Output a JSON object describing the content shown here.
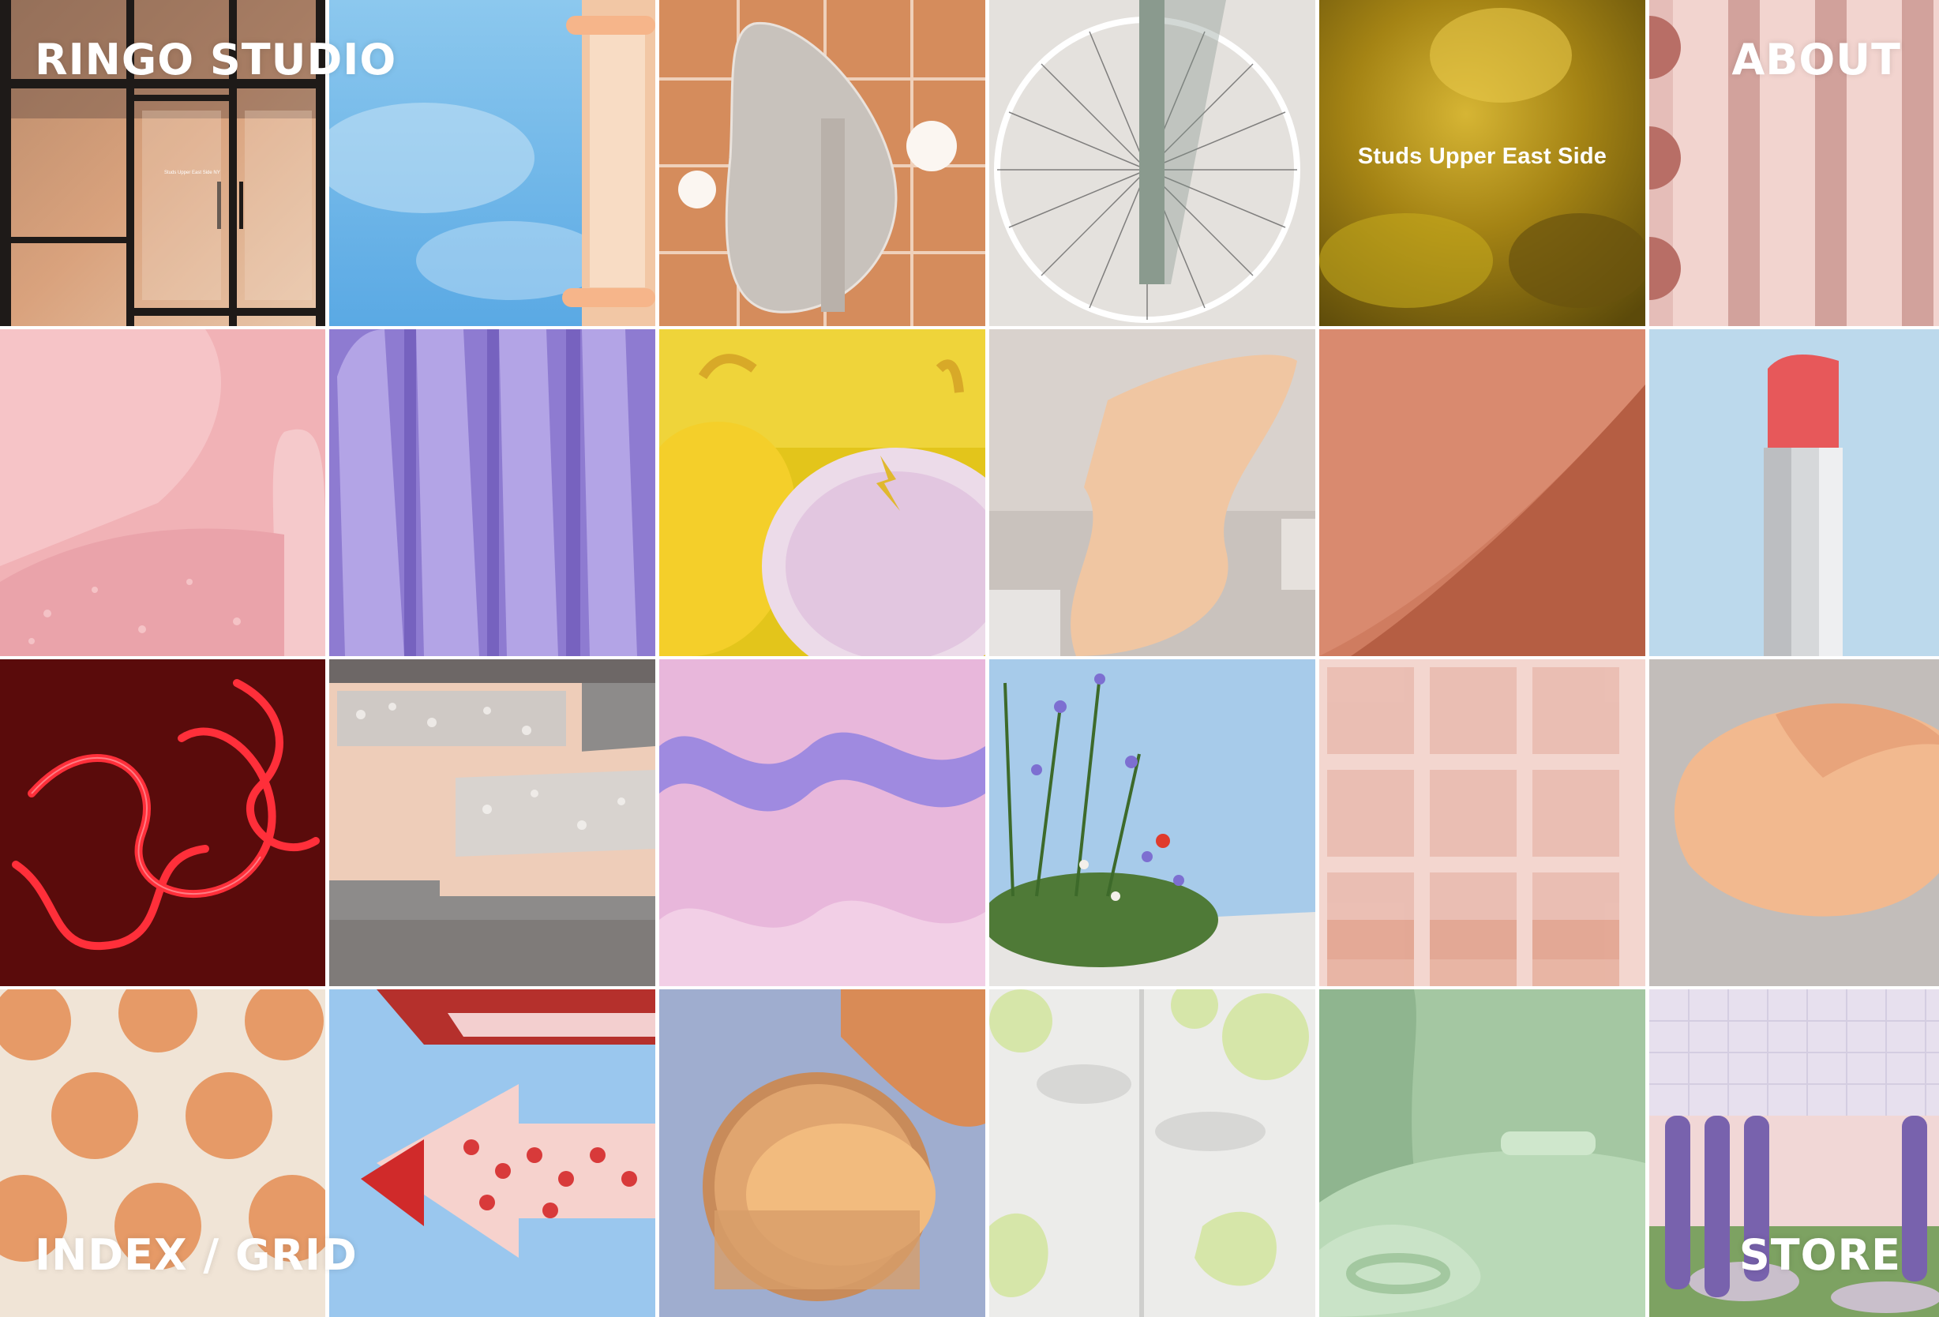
{
  "nav": {
    "brand": "RINGO STUDIO",
    "about": "ABOUT",
    "index_grid": "INDEX / GRID",
    "store": "STORE"
  },
  "tiles": {
    "storefront_sign": "Studs Upper East Side NY",
    "gold_caption": "Studs Upper East Side"
  },
  "colors": {
    "link_text": "#ffffff",
    "background": "#ffffff"
  }
}
